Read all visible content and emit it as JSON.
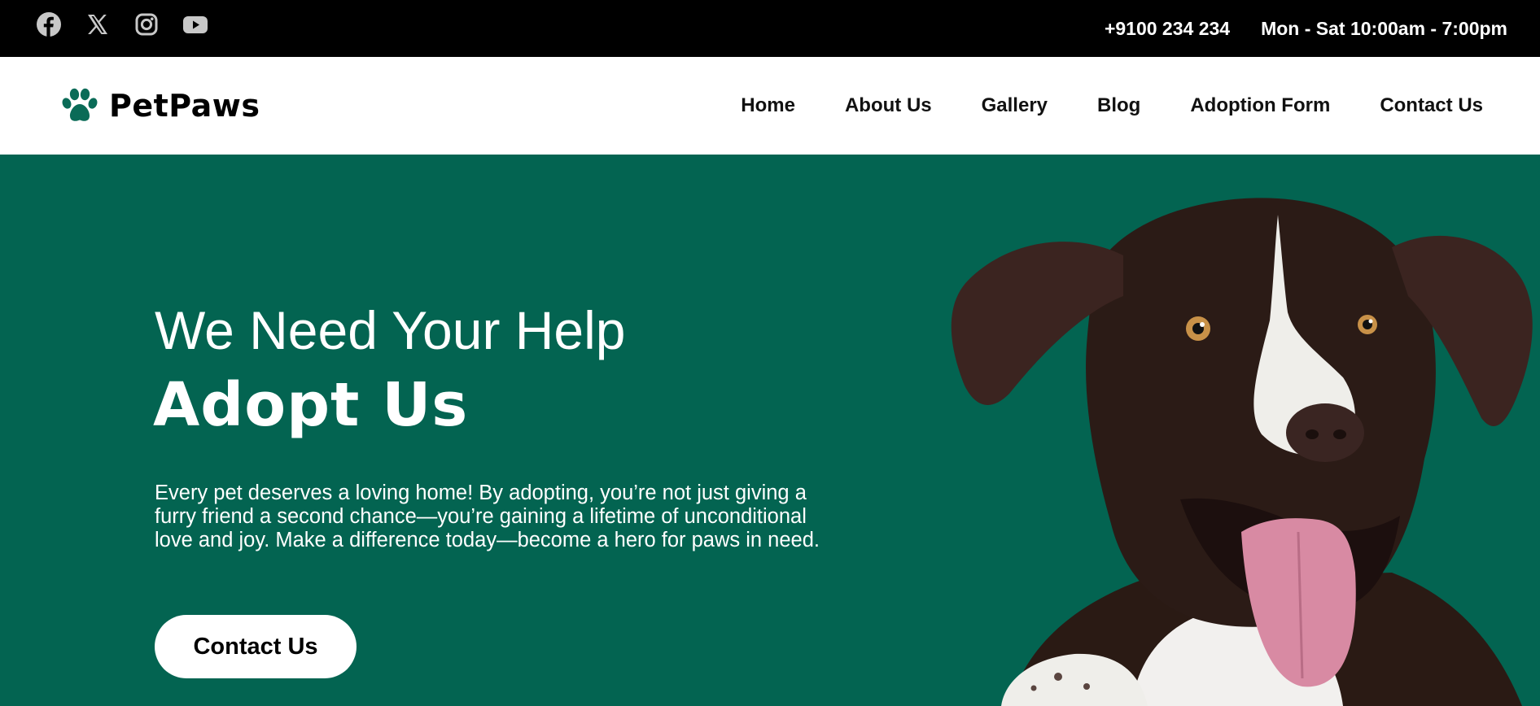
{
  "topbar": {
    "social_icons": [
      "facebook-icon",
      "x-twitter-icon",
      "instagram-icon",
      "youtube-icon"
    ],
    "phone": "+9100 234 234",
    "hours": "Mon - Sat 10:00am - 7:00pm"
  },
  "header": {
    "logo_icon": "paw-icon",
    "logo_text": "PetPaws",
    "nav": [
      "Home",
      "About Us",
      "Gallery",
      "Blog",
      "Adoption Form",
      "Contact Us"
    ]
  },
  "hero": {
    "subtitle": "We Need Your Help",
    "title": "Adopt Us",
    "description": "Every pet deserves a loving home! By adopting, you’re not just giving a furry friend a second chance—you’re gaining a lifetime of unconditional love and joy. Make a difference today—become a hero for paws in need.",
    "cta_label": "Contact Us",
    "image": "dog-photo"
  },
  "colors": {
    "topbar_bg": "#000000",
    "hero_bg": "#036451",
    "brand_accent": "#0a6b57",
    "icon_gray": "#c8c8c8"
  }
}
